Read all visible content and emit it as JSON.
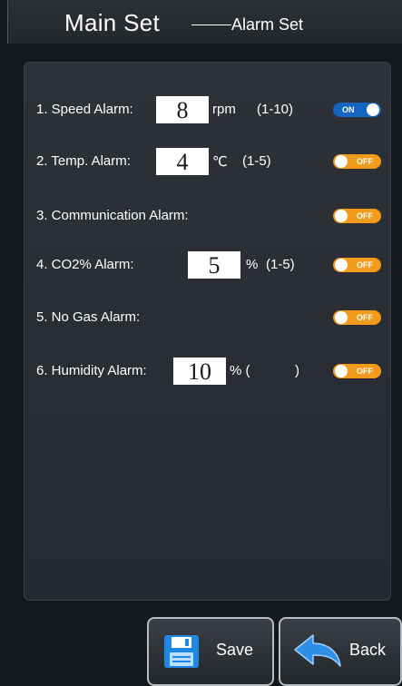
{
  "header": {
    "title": "Main Set",
    "subtitle": "Alarm Set"
  },
  "alarms": [
    {
      "label": "1. Speed Alarm:",
      "value": "8",
      "unit": "rpm",
      "range": "(1-10)",
      "toggle": "ON"
    },
    {
      "label": "2. Temp. Alarm:",
      "value": "4",
      "unit": "℃",
      "range": "(1-5)",
      "toggle": "OFF"
    },
    {
      "label": "3. Communication Alarm:",
      "toggle": "OFF"
    },
    {
      "label": "4. CO2% Alarm:",
      "value": "5",
      "unit": "%",
      "range": "(1-5)",
      "toggle": "OFF"
    },
    {
      "label": "5. No Gas Alarm:",
      "toggle": "OFF"
    },
    {
      "label": "6. Humidity Alarm:",
      "value": "10",
      "unit": "% (",
      "range": ")",
      "toggle": "OFF"
    }
  ],
  "buttons": {
    "save": "Save",
    "back": "Back"
  },
  "icons": {
    "save": "floppy-disk-icon",
    "back": "back-arrow-icon"
  },
  "colors": {
    "toggle_on": "#1565c0",
    "toggle_off": "#f29a1a",
    "background": "#14171c",
    "panel": "#2a2e34"
  }
}
